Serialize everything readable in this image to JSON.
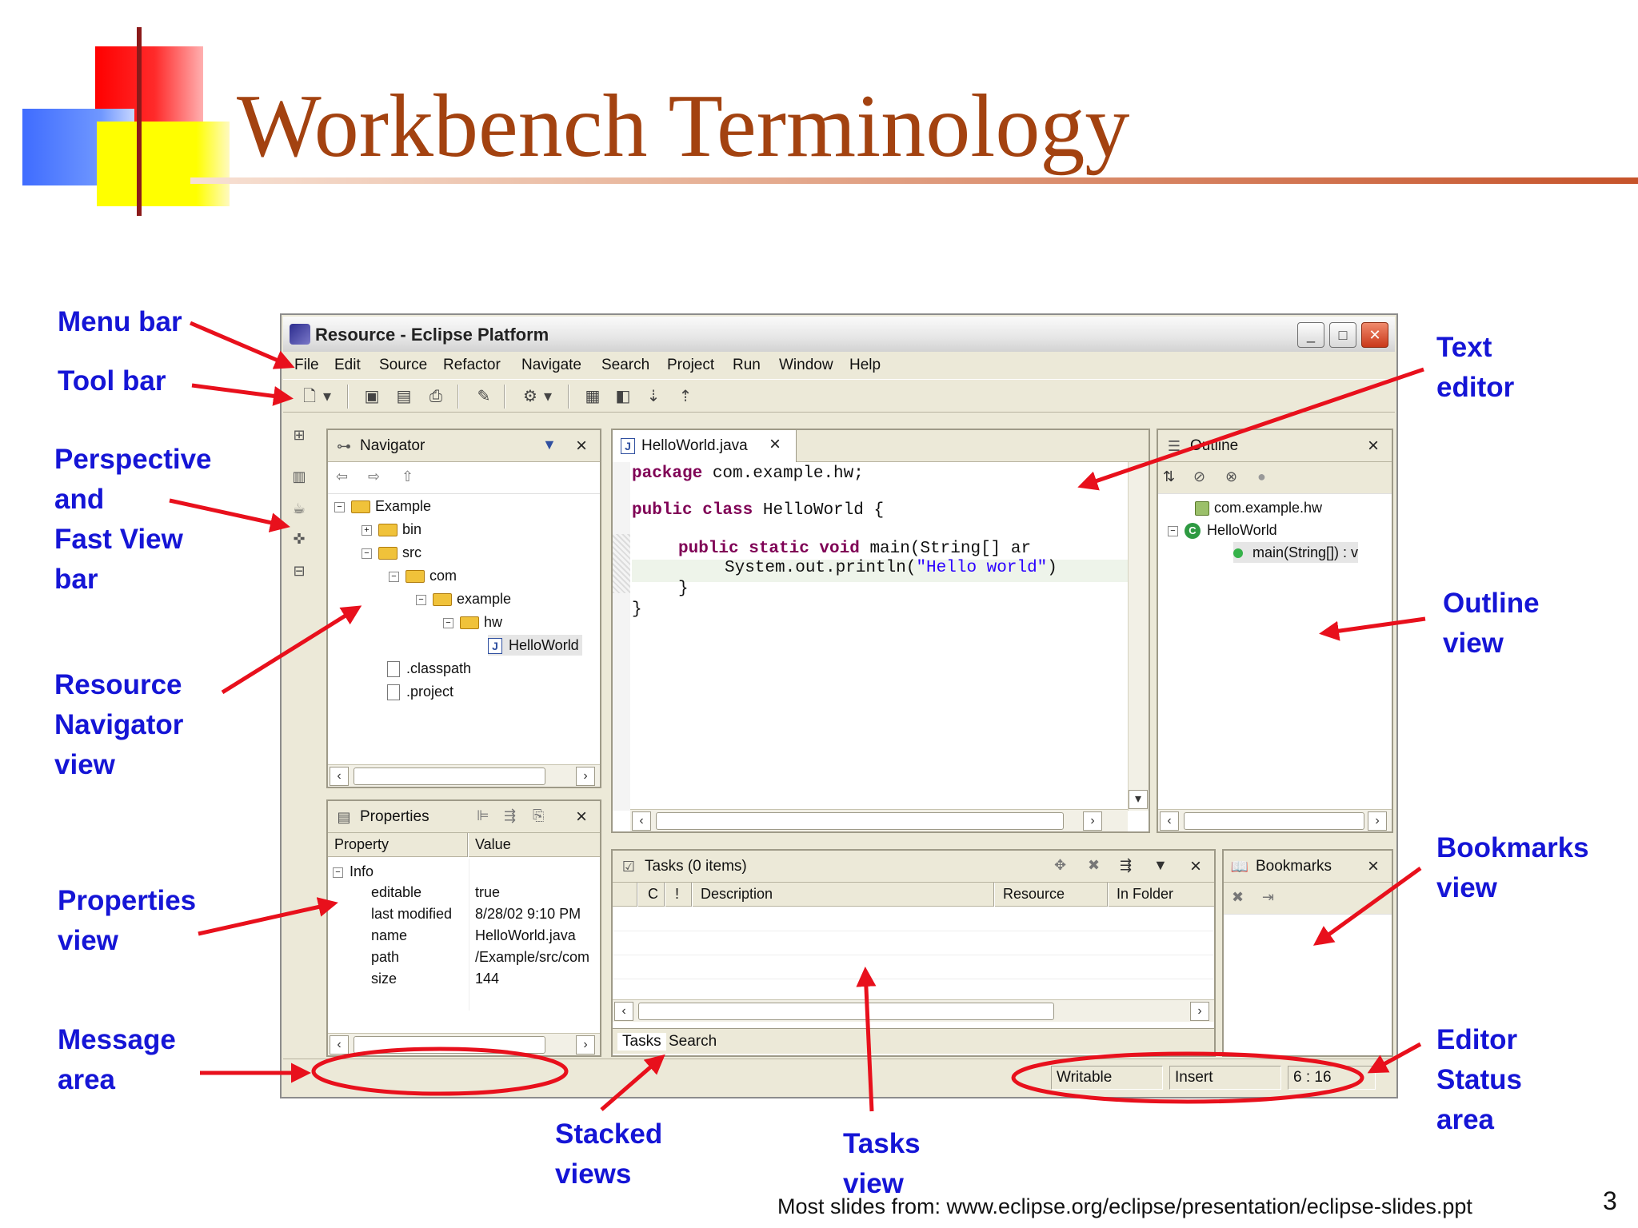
{
  "slide": {
    "title": "Workbench Terminology",
    "footer": "Most slides from: www.eclipse.org/eclipse/presentation/eclipse-slides.ppt",
    "page_number": "3"
  },
  "callouts": {
    "menu_bar": "Menu bar",
    "tool_bar": "Tool bar",
    "perspective_line1": "Perspective",
    "perspective_line2": "and",
    "perspective_line3": "Fast View",
    "perspective_line4": "bar",
    "resource_line1": "Resource",
    "resource_line2": "Navigator",
    "resource_line3": "view",
    "properties_line1": "Properties",
    "properties_line2": "view",
    "message_line1": "Message",
    "message_line2": "area",
    "stacked_line1": "Stacked",
    "stacked_line2": "views",
    "tasks_line1": "Tasks",
    "tasks_line2": "view",
    "text_line1": "Text",
    "text_line2": "editor",
    "outline_line1": "Outline",
    "outline_line2": "view",
    "bookmarks_line1": "Bookmarks",
    "bookmarks_line2": "view",
    "editor_status_line1": "Editor",
    "editor_status_line2": "Status",
    "editor_status_line3": "area"
  },
  "window": {
    "title": "Resource - Eclipse Platform",
    "minimize": "_",
    "maximize": "□",
    "close": "✕"
  },
  "menu": [
    "File",
    "Edit",
    "Source",
    "Refactor",
    "Navigate",
    "Search",
    "Project",
    "Run",
    "Window",
    "Help"
  ],
  "navigator": {
    "title": "Navigator",
    "tree": [
      "Example",
      "bin",
      "src",
      "com",
      "example",
      "hw",
      "HelloWorld",
      ".classpath",
      ".project"
    ]
  },
  "editor": {
    "tab": "HelloWorld.java",
    "lines": {
      "l1_kw": "package",
      "l1_rest": " com.example.hw;",
      "l2_kw": "public class",
      "l2_rest": " HelloWorld {",
      "l3_kw": "public static void",
      "l3_rest": " main(String[] ar",
      "l4_pre": "System.out.println(",
      "l4_str": "\"Hello world\"",
      "l4_post": ")",
      "l5": "}",
      "l6": "}"
    }
  },
  "outline": {
    "title": "Outline",
    "items": [
      "com.example.hw",
      "HelloWorld",
      "main(String[]) : v"
    ]
  },
  "properties": {
    "title": "Properties",
    "col_property": "Property",
    "col_value": "Value",
    "group": "Info",
    "rows": [
      {
        "name": "editable",
        "value": "true"
      },
      {
        "name": "last modified",
        "value": "8/28/02 9:10 PM"
      },
      {
        "name": "name",
        "value": "HelloWorld.java"
      },
      {
        "name": "path",
        "value": "/Example/src/com"
      },
      {
        "name": "size",
        "value": "144"
      }
    ]
  },
  "tasks": {
    "title": "Tasks (0 items)",
    "col_c": "C",
    "col_bang": "!",
    "col_description": "Description",
    "col_resource": "Resource",
    "col_folder": "In Folder",
    "stack_tabs": [
      "Tasks",
      "Search"
    ]
  },
  "bookmarks": {
    "title": "Bookmarks"
  },
  "status": {
    "writable": "Writable",
    "insert": "Insert",
    "position": "6 : 16"
  },
  "colors": {
    "callout": "#1515d6",
    "arrow": "#e8101c",
    "title": "#a34210"
  }
}
